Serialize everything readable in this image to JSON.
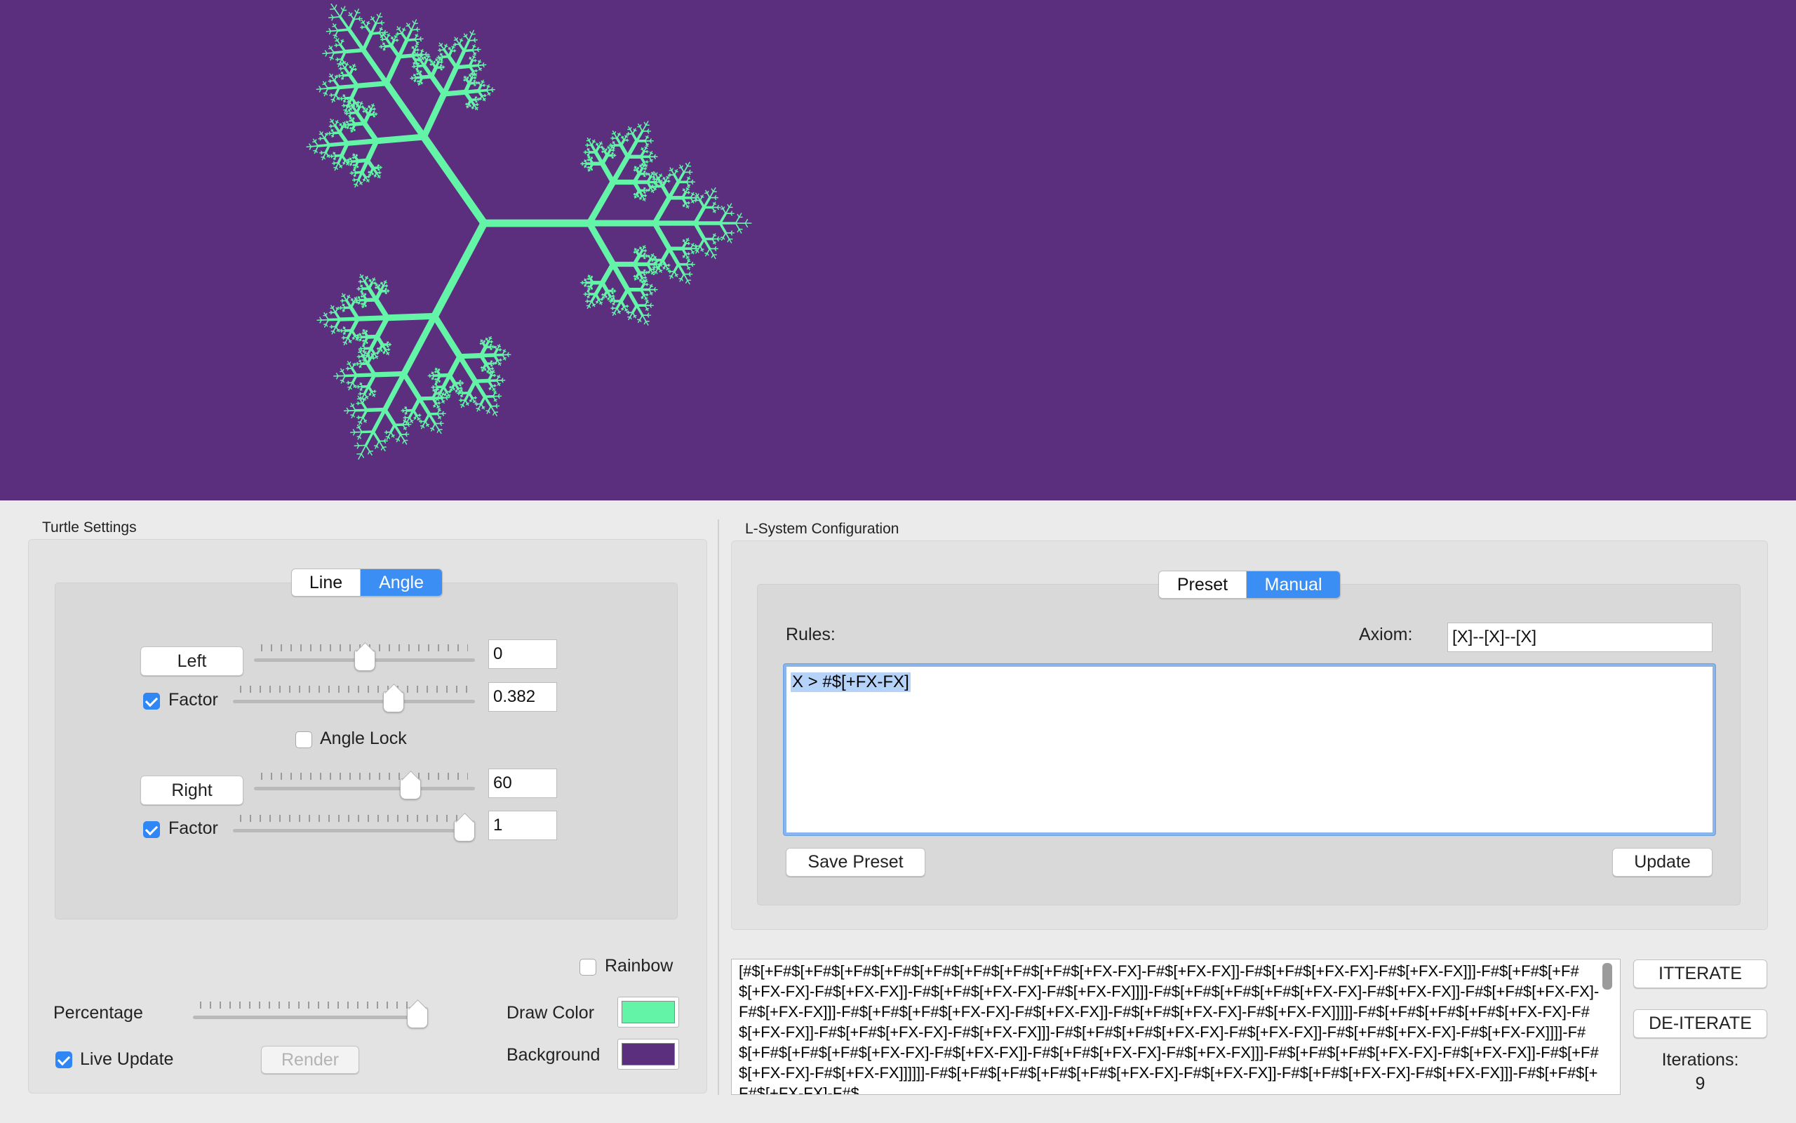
{
  "canvas": {
    "background_color": "#5b2e7e",
    "draw_color": "#64f4a8"
  },
  "turtle_settings": {
    "title": "Turtle Settings",
    "tabs": [
      {
        "label": "Line",
        "active": false
      },
      {
        "label": "Angle",
        "active": true
      }
    ],
    "left": {
      "button_label": "Left",
      "value": "0",
      "slider_fraction": 0.5,
      "factor_label": "Factor",
      "factor_checked": true,
      "factor_value": "0.382",
      "factor_slider_fraction": 0.68
    },
    "angle_lock": {
      "label": "Angle Lock",
      "checked": false
    },
    "right": {
      "button_label": "Right",
      "value": "60",
      "slider_fraction": 0.73,
      "factor_label": "Factor",
      "factor_checked": true,
      "factor_value": "1",
      "factor_slider_fraction": 1.0
    },
    "rainbow": {
      "label": "Rainbow",
      "checked": false
    },
    "percentage": {
      "label": "Percentage",
      "slider_fraction": 1.0
    },
    "draw_color": {
      "label": "Draw Color",
      "color": "#64f4a8"
    },
    "background": {
      "label": "Background",
      "color": "#5b2e7e"
    },
    "live_update": {
      "label": "Live Update",
      "checked": true
    },
    "render_label": "Render"
  },
  "lsystem": {
    "title": "L-System Configuration",
    "tabs": [
      {
        "label": "Preset",
        "active": false
      },
      {
        "label": "Manual",
        "active": true
      }
    ],
    "rules_label": "Rules:",
    "axiom_label": "Axiom:",
    "axiom_value": "[X]--[X]--[X]",
    "rules_value": "X > #$[+FX-FX]",
    "save_preset_label": "Save Preset",
    "update_label": "Update"
  },
  "output": {
    "text": "[#$[+F#$[+F#$[+F#$[+F#$[+F#$[+F#$[+F#$[+F#$[+FX-FX]-F#$[+FX-FX]]-F#$[+F#$[+FX-FX]-F#$[+FX-FX]]]-F#$[+F#$[+F#$[+FX-FX]-F#$[+FX-FX]]-F#$[+F#$[+FX-FX]-F#$[+FX-FX]]]]-F#$[+F#$[+F#$[+F#$[+FX-FX]-F#$[+FX-FX]]-F#$[+F#$[+FX-FX]-F#$[+FX-FX]]]-F#$[+F#$[+F#$[+FX-FX]-F#$[+FX-FX]]-F#$[+F#$[+FX-FX]-F#$[+FX-FX]]]]]-F#$[+F#$[+F#$[+F#$[+FX-FX]-F#$[+FX-FX]]-F#$[+F#$[+FX-FX]-F#$[+FX-FX]]]-F#$[+F#$[+F#$[+FX-FX]-F#$[+FX-FX]]-F#$[+F#$[+FX-FX]-F#$[+FX-FX]]]]-F#$[+F#$[+F#$[+F#$[+FX-FX]-F#$[+FX-FX]]-F#$[+F#$[+FX-FX]-F#$[+FX-FX]]]-F#$[+F#$[+F#$[+FX-FX]-F#$[+FX-FX]]-F#$[+F#$[+FX-FX]-F#$[+FX-FX]]]]]]-F#$[+F#$[+F#$[+F#$[+F#$[+FX-FX]-F#$[+FX-FX]]-F#$[+F#$[+FX-FX]-F#$[+FX-FX]]]-F#$[+F#$[+F#$[+FX-FX]-F#$",
    "iterate_label": "ITTERATE",
    "deiterate_label": "DE-ITERATE",
    "iterations_label": "Iterations:",
    "iterations_value": "9"
  }
}
